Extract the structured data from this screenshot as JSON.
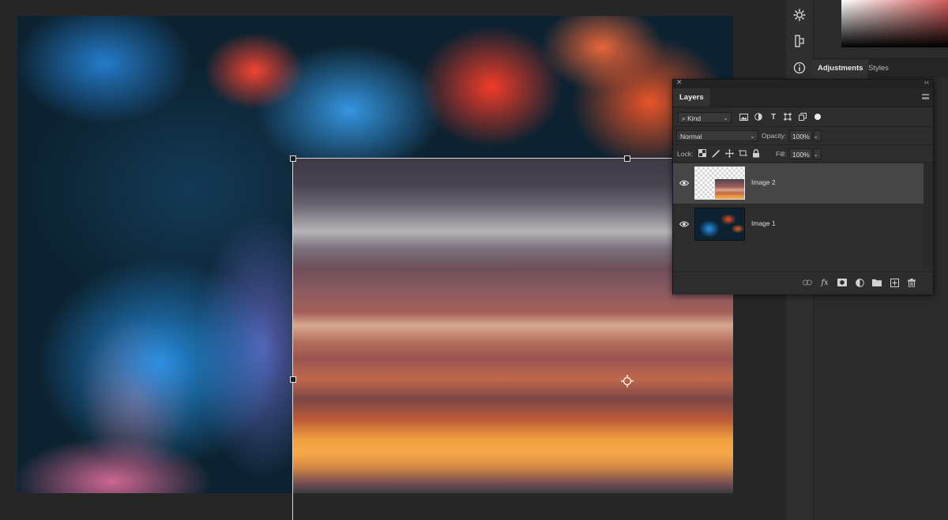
{
  "layers_panel": {
    "title": "Layers",
    "filter": {
      "kind_label": "Kind"
    },
    "blend_mode": "Normal",
    "opacity_label": "Opacity:",
    "opacity_value": "100%",
    "lock_label": "Lock:",
    "fill_label": "Fill:",
    "fill_value": "100%",
    "layers": [
      {
        "name": "Image 2",
        "visible": true,
        "selected": true
      },
      {
        "name": "Image 1",
        "visible": true,
        "selected": false
      }
    ]
  },
  "adjustments_tabs": [
    "Adjustments",
    "Styles"
  ],
  "icons": {
    "dock": [
      "gear-icon",
      "history-icon",
      "info-icon"
    ],
    "filter": [
      "image-filter-icon",
      "adjustment-filter-icon",
      "type-filter-icon",
      "shape-filter-icon",
      "smart-object-filter-icon",
      "filter-toggle-icon"
    ],
    "lock": [
      "lock-transparency-icon",
      "lock-image-icon",
      "lock-position-icon",
      "lock-artboard-icon",
      "lock-all-icon"
    ],
    "footer": [
      "link-layers-icon",
      "fx-icon",
      "add-mask-icon",
      "adjustment-layer-icon",
      "new-group-icon",
      "new-layer-icon",
      "delete-icon"
    ]
  },
  "colors": {
    "accent": "#ffffff",
    "panel_bg": "#2d2d2d",
    "selected_row": "#464646"
  }
}
